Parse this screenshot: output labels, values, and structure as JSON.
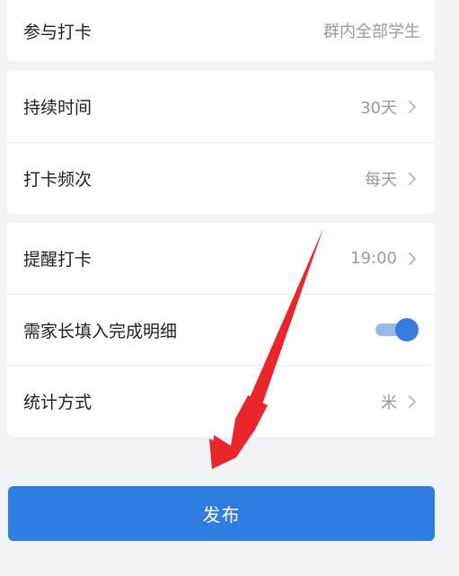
{
  "section_participants": {
    "label": "参与打卡",
    "value": "群内全部学生"
  },
  "section_schedule": {
    "duration": {
      "label": "持续时间",
      "value": "30天"
    },
    "frequency": {
      "label": "打卡频次",
      "value": "每天"
    }
  },
  "section_settings": {
    "reminder": {
      "label": "提醒打卡",
      "value": "19:00"
    },
    "parent_detail": {
      "label": "需家长填入完成明细",
      "enabled": true
    },
    "stat_method": {
      "label": "统计方式",
      "value": "米"
    }
  },
  "publish_button": {
    "label": "发布"
  },
  "colors": {
    "primary": "#2f7de1",
    "toggle_knob": "#3a7be0",
    "toggle_track": "#9bb9e8",
    "annotation_arrow": "#e8262c"
  }
}
